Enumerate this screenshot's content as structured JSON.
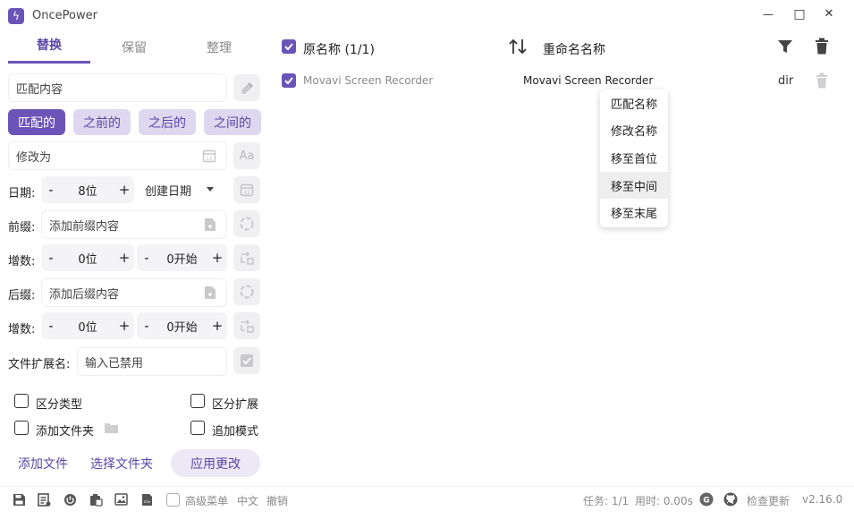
{
  "app": {
    "title": "OncePower",
    "logo_glyph": "ϟ",
    "accent": "#6b54b8",
    "accent_light": "#ddd8ef"
  },
  "window_controls": {
    "minimize": "—",
    "maximize": "□",
    "close": "✕"
  },
  "tabs": [
    {
      "label": "替换",
      "active": true
    },
    {
      "label": "保留",
      "active": false
    },
    {
      "label": "整理",
      "active": false
    }
  ],
  "match": {
    "placeholder": "匹配内容",
    "chips": [
      "匹配的",
      "之前的",
      "之后的",
      "之间的"
    ],
    "active_chip": 0
  },
  "modify": {
    "placeholder": "修改为",
    "case_label": "Aa"
  },
  "date": {
    "label": "日期:",
    "minus": "-",
    "value": "8位",
    "plus": "+",
    "select_value": "创建日期"
  },
  "prefix": {
    "label": "前缀:",
    "placeholder": "添加前缀内容"
  },
  "counter1": {
    "label": "增数:",
    "minus": "-",
    "digits": "0位",
    "plus": "+",
    "minus2": "-",
    "start": "0开始",
    "plus2": "+"
  },
  "suffix": {
    "label": "后缀:",
    "placeholder": "添加后缀内容"
  },
  "counter2": {
    "label": "增数:",
    "minus": "-",
    "digits": "0位",
    "plus": "+",
    "minus2": "-",
    "start": "0开始",
    "plus2": "+"
  },
  "extension": {
    "label": "文件扩展名:",
    "placeholder": "输入已禁用"
  },
  "options": {
    "type_sensitive": "区分类型",
    "ext_sensitive": "区分扩展",
    "add_folder": "添加文件夹",
    "append_mode": "追加模式"
  },
  "buttons": {
    "add_file": "添加文件",
    "select_folder": "选择文件夹",
    "apply": "应用更改"
  },
  "table": {
    "header_original": "原名称 (1/1)",
    "header_renamed": "重命名名称",
    "rows": [
      {
        "original": "Movavi Screen Recorder",
        "renamed": "Movavi Screen Recorder",
        "type": "dir",
        "checked": true
      }
    ]
  },
  "context_menu": {
    "items": [
      "匹配名称",
      "修改名称",
      "移至首位",
      "移至中间",
      "移至末尾"
    ],
    "hovered_index": 3
  },
  "status_bar": {
    "advanced_menu": "高级菜单",
    "language": "中文",
    "undo": "撤销",
    "task": "任务: 1/1",
    "elapsed": "用时: 0.00s",
    "check_update": "检查更新",
    "version": "v2.16.0"
  }
}
